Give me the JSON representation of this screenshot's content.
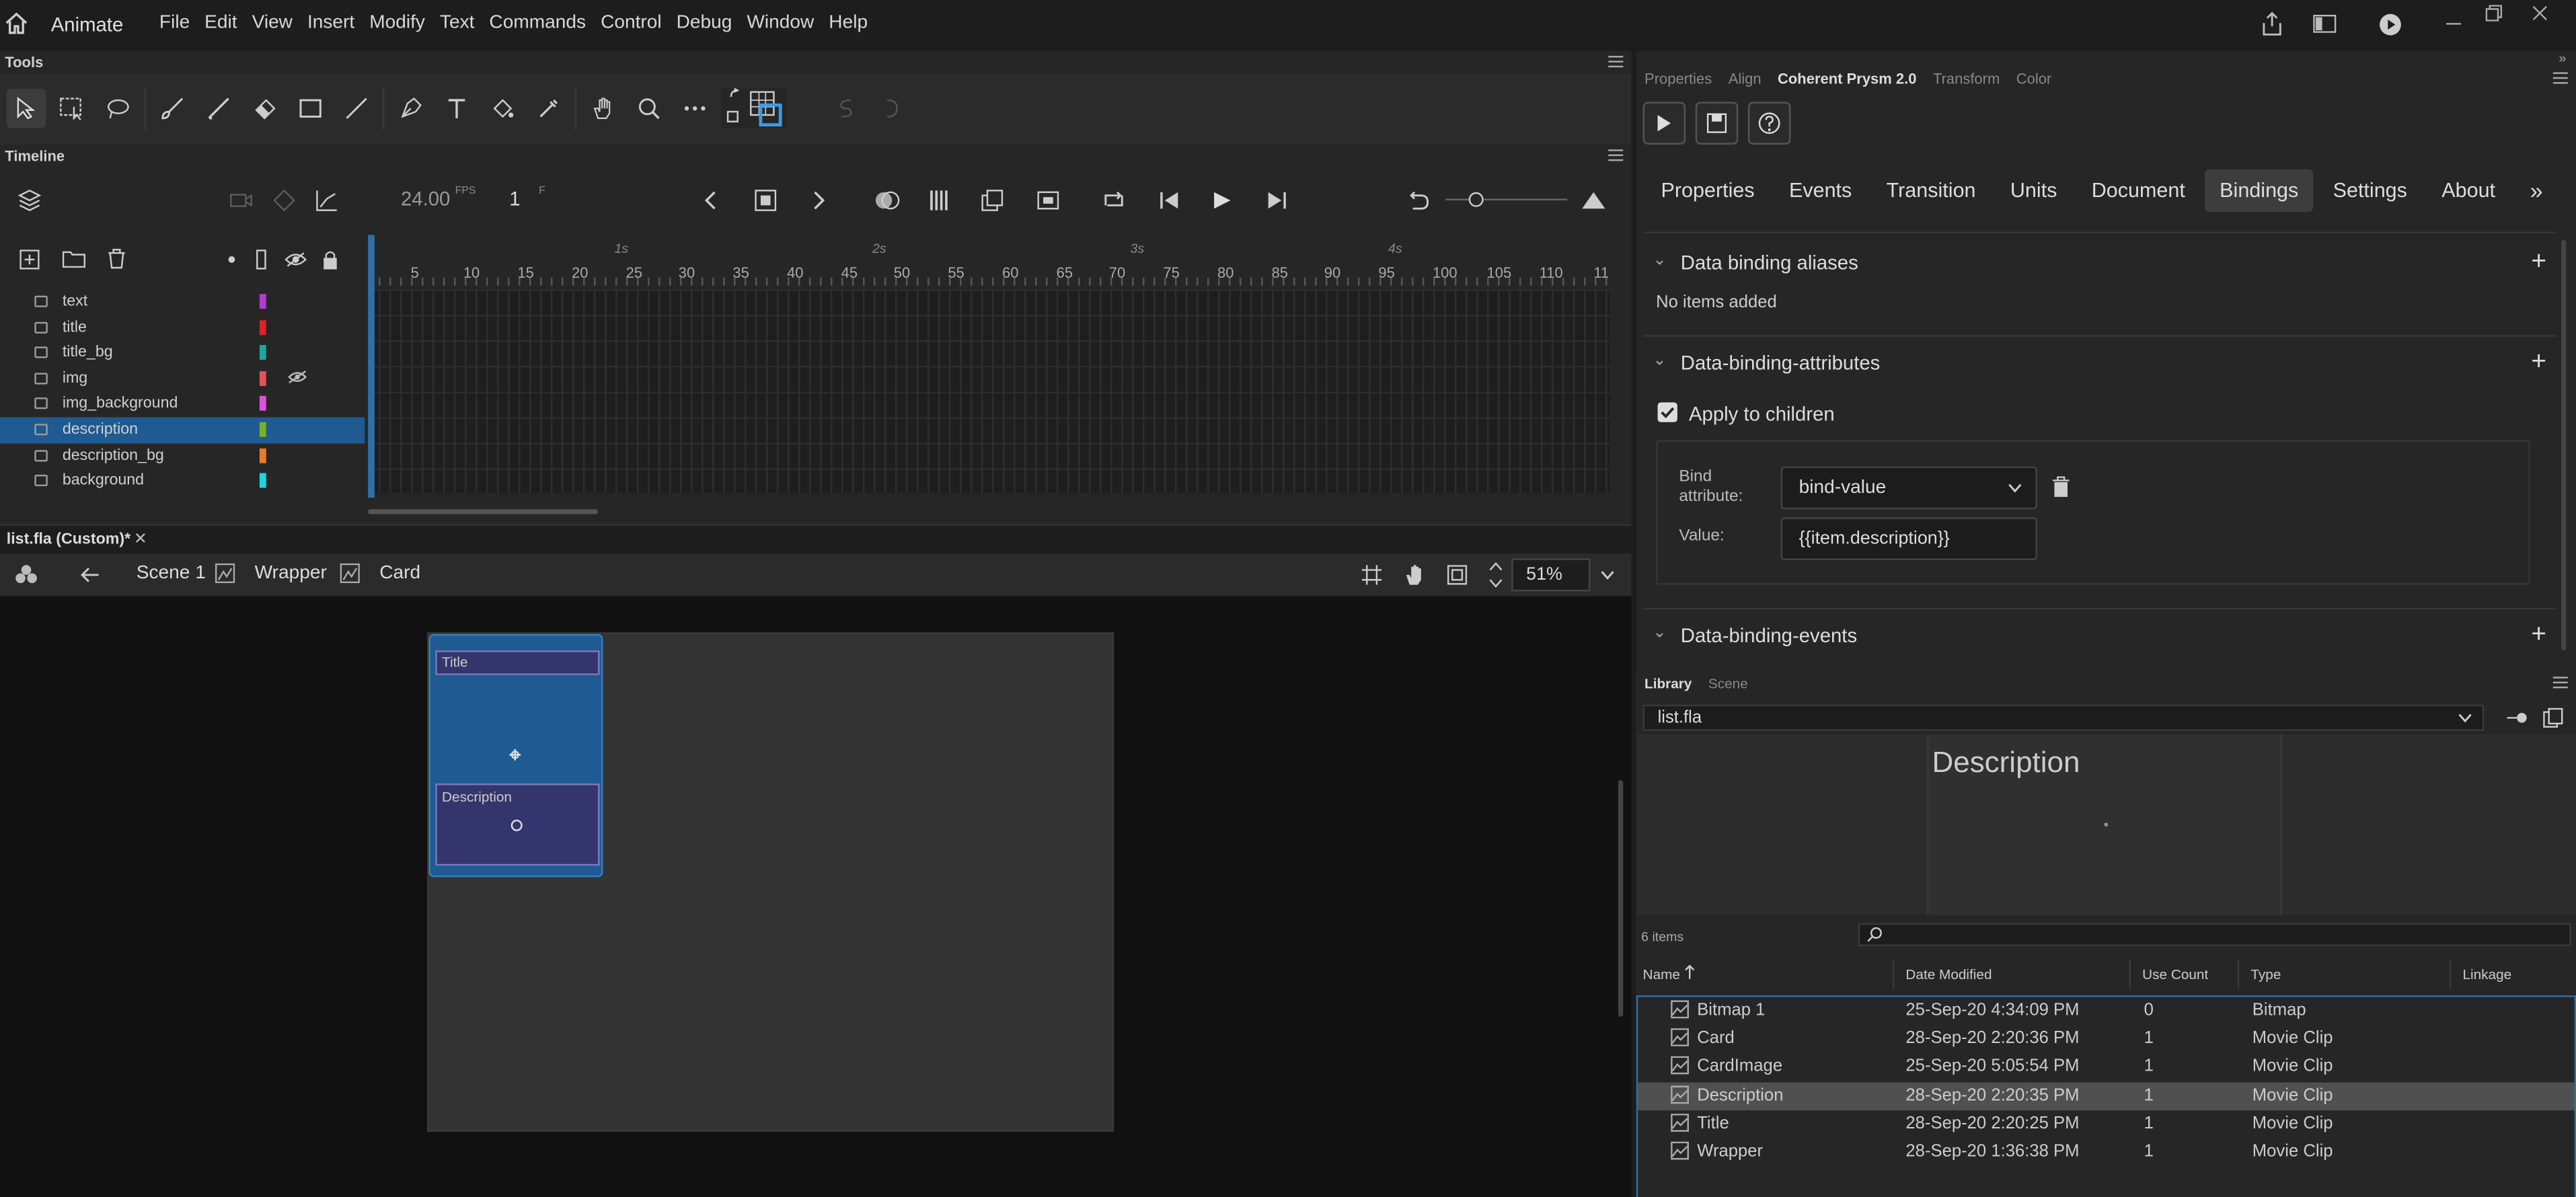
{
  "menubar": {
    "app_name": "Animate",
    "menus": [
      "File",
      "Edit",
      "View",
      "Insert",
      "Modify",
      "Text",
      "Commands",
      "Control",
      "Debug",
      "Window",
      "Help"
    ]
  },
  "tools_panel": {
    "title": "Tools"
  },
  "timeline": {
    "title": "Timeline",
    "fps_value": "24.00",
    "fps_unit": "FPS",
    "frame_value": "1",
    "frame_unit": "F",
    "seconds": [
      "1s",
      "2s",
      "3s",
      "4s"
    ],
    "frame_numbers": [
      "5",
      "10",
      "15",
      "20",
      "25",
      "30",
      "35",
      "40",
      "45",
      "50",
      "55",
      "60",
      "65",
      "70",
      "75",
      "80",
      "85",
      "90",
      "95",
      "100",
      "105",
      "110",
      "11"
    ],
    "layers": [
      {
        "name": "text",
        "color": "#b23cd2",
        "selected": false,
        "hidden": false
      },
      {
        "name": "title",
        "color": "#e0202a",
        "selected": false,
        "hidden": false
      },
      {
        "name": "title_bg",
        "color": "#1aa8a0",
        "selected": false,
        "hidden": false
      },
      {
        "name": "img",
        "color": "#e8505a",
        "selected": false,
        "hidden": true
      },
      {
        "name": "img_background",
        "color": "#e050e0",
        "selected": false,
        "hidden": false
      },
      {
        "name": "description",
        "color": "#7ab020",
        "selected": true,
        "hidden": false
      },
      {
        "name": "description_bg",
        "color": "#f07a20",
        "selected": false,
        "hidden": false
      },
      {
        "name": "background",
        "color": "#18d8e0",
        "selected": false,
        "hidden": false
      }
    ]
  },
  "document": {
    "tab_label": "list.fla (Custom)*",
    "breadcrumb": [
      "Scene 1",
      "Wrapper",
      "Card"
    ],
    "zoom": "51%"
  },
  "stage": {
    "title_label": "Title",
    "description_label": "Description"
  },
  "right_panel": {
    "tabs": [
      "Properties",
      "Align",
      "Coherent Prysm 2.0",
      "Transform",
      "Color"
    ],
    "active_tab": "Coherent Prysm 2.0",
    "subtabs": [
      "Properties",
      "Events",
      "Transition",
      "Units",
      "Document",
      "Bindings",
      "Settings",
      "About"
    ],
    "active_subtab": "Bindings",
    "sections": {
      "aliases_title": "Data binding aliases",
      "aliases_empty": "No items added",
      "attributes_title": "Data-binding-attributes",
      "apply_children_label": "Apply to children",
      "apply_children_checked": true,
      "bind_attribute_label": "Bind attribute:",
      "bind_attribute_value": "bind-value",
      "value_label": "Value:",
      "value_value": "{{item.description}}",
      "events_title": "Data-binding-events"
    }
  },
  "library": {
    "tabs": [
      "Library",
      "Scene"
    ],
    "active_tab": "Library",
    "file": "list.fla",
    "preview_title": "Description",
    "item_count": "6 items",
    "columns": [
      "Name",
      "Date Modified",
      "Use Count",
      "Type",
      "Linkage"
    ],
    "rows": [
      {
        "name": "Bitmap 1",
        "date": "25-Sep-20 4:34:09 PM",
        "count": "0",
        "type": "Bitmap",
        "selected": false
      },
      {
        "name": "Card",
        "date": "28-Sep-20 2:20:36 PM",
        "count": "1",
        "type": "Movie Clip",
        "selected": false
      },
      {
        "name": "CardImage",
        "date": "25-Sep-20 5:05:54 PM",
        "count": "1",
        "type": "Movie Clip",
        "selected": false
      },
      {
        "name": "Description",
        "date": "28-Sep-20 2:20:35 PM",
        "count": "1",
        "type": "Movie Clip",
        "selected": true
      },
      {
        "name": "Title",
        "date": "28-Sep-20 2:20:25 PM",
        "count": "1",
        "type": "Movie Clip",
        "selected": false
      },
      {
        "name": "Wrapper",
        "date": "28-Sep-20 1:36:38 PM",
        "count": "1",
        "type": "Movie Clip",
        "selected": false
      }
    ]
  }
}
